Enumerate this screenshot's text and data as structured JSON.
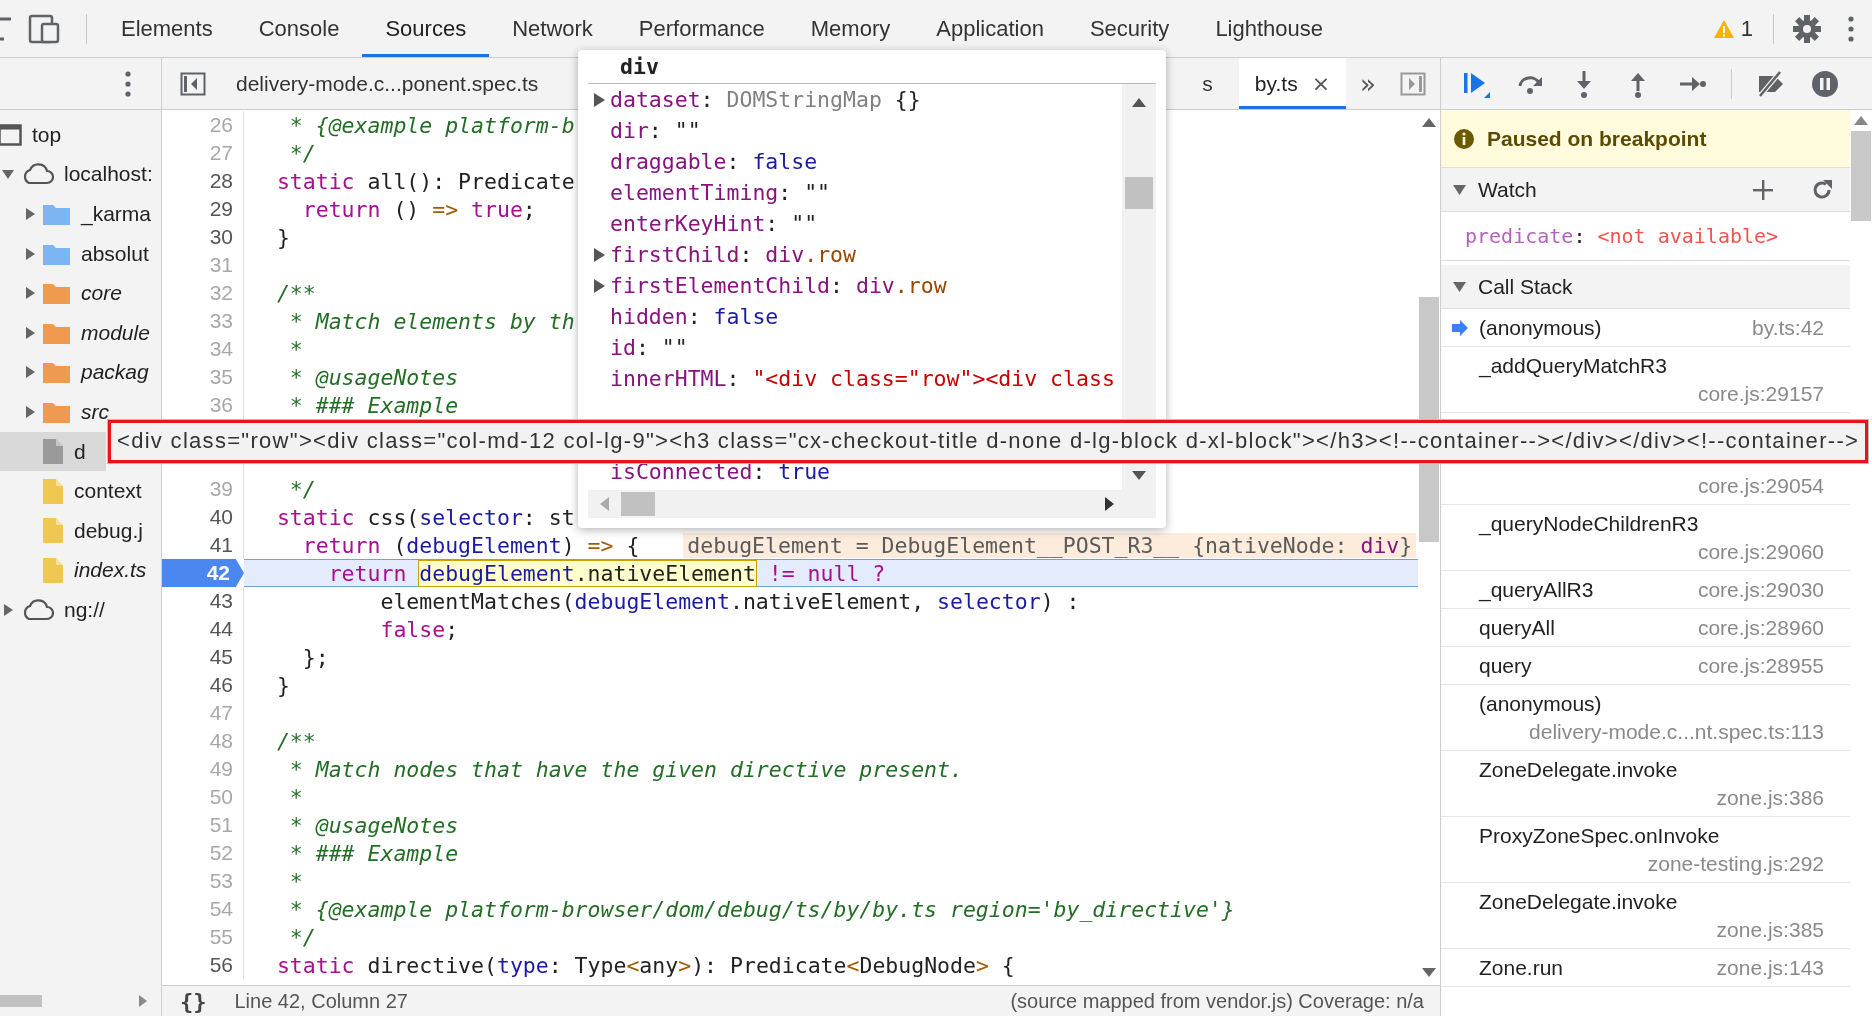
{
  "toolbar": {
    "tabs": [
      {
        "label": "Elements",
        "selected": false
      },
      {
        "label": "Console",
        "selected": false
      },
      {
        "label": "Sources",
        "selected": true
      },
      {
        "label": "Network",
        "selected": false
      },
      {
        "label": "Performance",
        "selected": false
      },
      {
        "label": "Memory",
        "selected": false
      },
      {
        "label": "Application",
        "selected": false
      },
      {
        "label": "Security",
        "selected": false
      },
      {
        "label": "Lighthouse",
        "selected": false
      }
    ],
    "warnings": "1"
  },
  "navigator": {
    "tree": [
      {
        "label": "top",
        "kind": "frame",
        "selected": false,
        "children": [
          {
            "label": "localhost:",
            "kind": "cloud",
            "selected": false,
            "expanded": true,
            "children": [
              {
                "label": "_karma",
                "kind": "folder",
                "color": "#7db4f2",
                "selected": false,
                "expanded": false,
                "source_mapped": false
              },
              {
                "label": "absolut",
                "kind": "folder",
                "color": "#7db4f2",
                "selected": false,
                "expanded": false,
                "source_mapped": false
              },
              {
                "label": "core",
                "kind": "folder",
                "color": "#ef9a4f",
                "selected": false,
                "expanded": false,
                "source_mapped": true
              },
              {
                "label": "module",
                "kind": "folder",
                "color": "#ef9a4f",
                "selected": false,
                "expanded": false,
                "source_mapped": true
              },
              {
                "label": "packag",
                "kind": "folder",
                "color": "#ef9a4f",
                "selected": false,
                "expanded": false,
                "source_mapped": true
              },
              {
                "label": "src",
                "kind": "folder",
                "color": "#ef9a4f",
                "selected": false,
                "expanded": false,
                "source_mapped": true
              },
              {
                "label": "d",
                "kind": "file",
                "color": "#9a9a9a",
                "selected": true,
                "source_mapped": false
              },
              {
                "label": "context",
                "kind": "file",
                "color": "#f0c850",
                "selected": false,
                "source_mapped": false
              },
              {
                "label": "debug.j",
                "kind": "file",
                "color": "#f0c850",
                "selected": false,
                "source_mapped": false
              },
              {
                "label": "index.ts",
                "kind": "file",
                "color": "#f0c850",
                "selected": false,
                "source_mapped": true
              }
            ]
          },
          {
            "label": "ng://",
            "kind": "cloud",
            "selected": false,
            "expanded": false
          }
        ]
      }
    ]
  },
  "editor": {
    "tabs": [
      {
        "label": "delivery-mode.c...ponent.spec.ts",
        "selected": false
      },
      {
        "label": "s",
        "selected": false
      },
      {
        "label": "by.ts",
        "selected": true,
        "close": "×"
      }
    ],
    "overflow": "»",
    "lines": [
      {
        "kind": "code",
        "number": "26",
        "breakable": false,
        "current": false,
        "breakpoint": false,
        "tokens": [
          {
            "kind": "comment",
            "text": "   * {@example platform-b"
          }
        ]
      },
      {
        "kind": "code",
        "number": "27",
        "breakable": false,
        "current": false,
        "breakpoint": false,
        "tokens": [
          {
            "kind": "comment",
            "text": "   */"
          }
        ]
      },
      {
        "kind": "code",
        "number": "28",
        "breakable": true,
        "current": false,
        "breakpoint": false,
        "tokens": [
          {
            "kind": "keyword",
            "text": "  static"
          },
          {
            "kind": "plain",
            "text": " all(): Predicate"
          }
        ]
      },
      {
        "kind": "code",
        "number": "29",
        "breakable": true,
        "current": false,
        "breakpoint": false,
        "tokens": [
          {
            "kind": "keyword",
            "text": "    return"
          },
          {
            "kind": "plain",
            "text": " () "
          },
          {
            "kind": "operator",
            "text": "=>"
          },
          {
            "kind": "keyword",
            "text": " true"
          },
          {
            "kind": "plain",
            "text": ";"
          }
        ]
      },
      {
        "kind": "code",
        "number": "30",
        "breakable": true,
        "current": false,
        "breakpoint": false,
        "tokens": [
          {
            "kind": "plain",
            "text": "  }"
          }
        ]
      },
      {
        "kind": "code",
        "number": "31",
        "breakable": false,
        "current": false,
        "breakpoint": false
      },
      {
        "kind": "code",
        "number": "32",
        "breakable": false,
        "current": false,
        "breakpoint": false,
        "tokens": [
          {
            "kind": "comment",
            "text": "  /**"
          }
        ]
      },
      {
        "kind": "code",
        "number": "33",
        "breakable": false,
        "current": false,
        "breakpoint": false,
        "tokens": [
          {
            "kind": "comment",
            "text": "   * Match elements by th"
          }
        ]
      },
      {
        "kind": "code",
        "number": "34",
        "breakable": false,
        "current": false,
        "breakpoint": false,
        "tokens": [
          {
            "kind": "comment",
            "text": "   *"
          }
        ]
      },
      {
        "kind": "code",
        "number": "35",
        "breakable": false,
        "current": false,
        "breakpoint": false,
        "tokens": [
          {
            "kind": "comment",
            "text": "   * @usageNotes"
          }
        ]
      },
      {
        "kind": "code",
        "number": "36",
        "breakable": false,
        "current": false,
        "breakpoint": false,
        "tokens": [
          {
            "kind": "comment",
            "text": "   * ### Example"
          }
        ]
      },
      {
        "kind": "covered"
      },
      {
        "kind": "covered"
      },
      {
        "kind": "code",
        "number": "39",
        "breakable": false,
        "current": false,
        "breakpoint": false,
        "tokens": [
          {
            "kind": "comment",
            "text": "   */"
          }
        ]
      },
      {
        "kind": "code",
        "number": "40",
        "breakable": true,
        "current": false,
        "breakpoint": false,
        "tokens": [
          {
            "kind": "keyword",
            "text": "  static"
          },
          {
            "kind": "plain",
            "text": " css("
          },
          {
            "kind": "variable",
            "text": "selector"
          },
          {
            "kind": "plain",
            "text": ": st"
          }
        ]
      },
      {
        "kind": "code",
        "number": "41",
        "breakable": true,
        "current": false,
        "breakpoint": false,
        "tokens": [
          {
            "kind": "keyword",
            "text": "    return"
          },
          {
            "kind": "plain",
            "text": " ("
          },
          {
            "kind": "variable",
            "text": "debugElement"
          },
          {
            "kind": "plain",
            "text": ") "
          },
          {
            "kind": "operator",
            "text": "=>"
          },
          {
            "kind": "plain",
            "text": " {"
          }
        ],
        "inline_value": [
          {
            "kind": "plain",
            "text": "debugElement = DebugElement__POST_R3__ {nativeNode: "
          },
          {
            "kind": "tag",
            "text": "div"
          },
          {
            "kind": "plain",
            "text": "}"
          }
        ]
      },
      {
        "kind": "code",
        "number": "42",
        "breakable": true,
        "current": true,
        "breakpoint": true,
        "tokens": [
          {
            "kind": "keyword",
            "text": "      return "
          },
          {
            "kind": "evaluated",
            "parts": [
              {
                "kind": "variable",
                "text": "debugElement"
              },
              {
                "kind": "plain",
                "text": ".nativeElement"
              }
            ]
          },
          {
            "kind": "keyword",
            "text": " != null ?"
          }
        ]
      },
      {
        "kind": "code",
        "number": "43",
        "breakable": true,
        "current": false,
        "breakpoint": false,
        "tokens": [
          {
            "kind": "plain",
            "text": "          elementMatches("
          },
          {
            "kind": "variable",
            "text": "debugElement"
          },
          {
            "kind": "plain",
            "text": ".nativeElement, "
          },
          {
            "kind": "variable",
            "text": "selector"
          },
          {
            "kind": "plain",
            "text": ") :"
          }
        ]
      },
      {
        "kind": "code",
        "number": "44",
        "breakable": true,
        "current": false,
        "breakpoint": false,
        "tokens": [
          {
            "kind": "keyword",
            "text": "          false"
          },
          {
            "kind": "plain",
            "text": ";"
          }
        ]
      },
      {
        "kind": "code",
        "number": "45",
        "breakable": true,
        "current": false,
        "breakpoint": false,
        "tokens": [
          {
            "kind": "plain",
            "text": "    };"
          }
        ]
      },
      {
        "kind": "code",
        "number": "46",
        "breakable": true,
        "current": false,
        "breakpoint": false,
        "tokens": [
          {
            "kind": "plain",
            "text": "  }"
          }
        ]
      },
      {
        "kind": "code",
        "number": "47",
        "breakable": false,
        "current": false,
        "breakpoint": false
      },
      {
        "kind": "code",
        "number": "48",
        "breakable": false,
        "current": false,
        "breakpoint": false,
        "tokens": [
          {
            "kind": "comment",
            "text": "  /**"
          }
        ]
      },
      {
        "kind": "code",
        "number": "49",
        "breakable": false,
        "current": false,
        "breakpoint": false,
        "tokens": [
          {
            "kind": "comment",
            "text": "   * Match nodes that have the given directive present."
          }
        ]
      },
      {
        "kind": "code",
        "number": "50",
        "breakable": false,
        "current": false,
        "breakpoint": false,
        "tokens": [
          {
            "kind": "comment",
            "text": "   *"
          }
        ]
      },
      {
        "kind": "code",
        "number": "51",
        "breakable": false,
        "current": false,
        "breakpoint": false,
        "tokens": [
          {
            "kind": "comment",
            "text": "   * @usageNotes"
          }
        ]
      },
      {
        "kind": "code",
        "number": "52",
        "breakable": false,
        "current": false,
        "breakpoint": false,
        "tokens": [
          {
            "kind": "comment",
            "text": "   * ### Example"
          }
        ]
      },
      {
        "kind": "code",
        "number": "53",
        "breakable": false,
        "current": false,
        "breakpoint": false,
        "tokens": [
          {
            "kind": "comment",
            "text": "   *"
          }
        ]
      },
      {
        "kind": "code",
        "number": "54",
        "breakable": false,
        "current": false,
        "breakpoint": false,
        "tokens": [
          {
            "kind": "comment",
            "text": "   * {@example platform-browser/dom/debug/ts/by/by.ts region='by_directive'}"
          }
        ]
      },
      {
        "kind": "code",
        "number": "55",
        "breakable": false,
        "current": false,
        "breakpoint": false,
        "tokens": [
          {
            "kind": "comment",
            "text": "   */"
          }
        ]
      },
      {
        "kind": "code",
        "number": "56",
        "breakable": true,
        "current": false,
        "breakpoint": false,
        "tokens": [
          {
            "kind": "keyword",
            "text": "  static"
          },
          {
            "kind": "plain",
            "text": " directive("
          },
          {
            "kind": "variable",
            "text": "type"
          },
          {
            "kind": "plain",
            "text": ": Type"
          },
          {
            "kind": "operator",
            "text": "<"
          },
          {
            "kind": "plain",
            "text": "any"
          },
          {
            "kind": "operator",
            "text": ">"
          },
          {
            "kind": "plain",
            "text": "): Predicate"
          },
          {
            "kind": "operator",
            "text": "<"
          },
          {
            "kind": "plain",
            "text": "DebugNode"
          },
          {
            "kind": "operator",
            "text": ">"
          },
          {
            "kind": "plain",
            "text": " {"
          }
        ]
      }
    ],
    "status": {
      "format": "{}",
      "position": "Line 42, Column 27",
      "source": "(source mapped from vendor.js) Coverage: n/a"
    }
  },
  "popup": {
    "title": "div",
    "properties": [
      {
        "kind": "property",
        "expandable": true,
        "tokens": [
          {
            "kind": "key",
            "text": "dataset"
          },
          {
            "kind": "plain",
            "text": ": "
          },
          {
            "kind": "type",
            "text": "DOMStringMap"
          },
          {
            "kind": "plain",
            "text": " {}"
          }
        ]
      },
      {
        "kind": "property",
        "expandable": false,
        "tokens": [
          {
            "kind": "key",
            "text": "dir"
          },
          {
            "kind": "plain",
            "text": ": \"\""
          }
        ]
      },
      {
        "kind": "property",
        "expandable": false,
        "tokens": [
          {
            "kind": "key",
            "text": "draggable"
          },
          {
            "kind": "plain",
            "text": ": "
          },
          {
            "kind": "boolean",
            "text": "false"
          }
        ]
      },
      {
        "kind": "property",
        "expandable": false,
        "tokens": [
          {
            "kind": "key",
            "text": "elementTiming"
          },
          {
            "kind": "plain",
            "text": ": \"\""
          }
        ]
      },
      {
        "kind": "property",
        "expandable": false,
        "tokens": [
          {
            "kind": "key",
            "text": "enterKeyHint"
          },
          {
            "kind": "plain",
            "text": ": \"\""
          }
        ]
      },
      {
        "kind": "property",
        "expandable": true,
        "tokens": [
          {
            "kind": "key",
            "text": "firstChild"
          },
          {
            "kind": "plain",
            "text": ": "
          },
          {
            "kind": "tag",
            "text": "div"
          },
          {
            "kind": "class",
            "text": ".row"
          }
        ]
      },
      {
        "kind": "property",
        "expandable": true,
        "tokens": [
          {
            "kind": "key",
            "text": "firstElementChild"
          },
          {
            "kind": "plain",
            "text": ": "
          },
          {
            "kind": "tag",
            "text": "div"
          },
          {
            "kind": "class",
            "text": ".row"
          }
        ]
      },
      {
        "kind": "property",
        "expandable": false,
        "tokens": [
          {
            "kind": "key",
            "text": "hidden"
          },
          {
            "kind": "plain",
            "text": ": "
          },
          {
            "kind": "boolean",
            "text": "false"
          }
        ]
      },
      {
        "kind": "property",
        "expandable": false,
        "tokens": [
          {
            "kind": "key",
            "text": "id"
          },
          {
            "kind": "plain",
            "text": ": \"\""
          }
        ]
      },
      {
        "kind": "property",
        "expandable": false,
        "tokens": [
          {
            "kind": "key",
            "text": "innerHTML"
          },
          {
            "kind": "plain",
            "text": ": "
          },
          {
            "kind": "string",
            "text": "\"<div class=\"row\"><div class"
          }
        ]
      },
      {
        "kind": "covered"
      },
      {
        "kind": "covered"
      },
      {
        "kind": "property",
        "expandable": false,
        "tokens": [
          {
            "kind": "key",
            "text": "isConnected"
          },
          {
            "kind": "plain",
            "text": ": "
          },
          {
            "kind": "boolean",
            "text": "true"
          }
        ]
      }
    ]
  },
  "tooltip": {
    "text": "<div class=\"row\"><div class=\"col-md-12 col-lg-9\"><h3 class=\"cx-checkout-title d-none d-lg-block d-xl-block\"></h3><!--container--></div></div><!--container-->"
  },
  "debugger": {
    "status": "Paused on breakpoint",
    "watch": {
      "title": "Watch",
      "expanded": true,
      "expressions": [
        {
          "tokens": [
            {
              "kind": "name",
              "text": "predicate"
            },
            {
              "kind": "plain",
              "text": ": "
            },
            {
              "kind": "error",
              "text": "<not available>"
            }
          ]
        }
      ]
    },
    "call_stack": {
      "title": "Call Stack",
      "expanded": true,
      "frames": [
        {
          "name": "(anonymous)",
          "location": "by.ts:42",
          "current": true
        },
        {
          "name": "_addQueryMatchR3",
          "location": "core.js:29157",
          "current": false
        },
        {
          "location": "core.js:29054",
          "current": false
        },
        {
          "name": "_queryNodeChildrenR3",
          "location": "core.js:29060",
          "current": false
        },
        {
          "name": "_queryAllR3",
          "location": "core.js:29030",
          "current": false
        },
        {
          "name": "queryAll",
          "location": "core.js:28960",
          "current": false
        },
        {
          "name": "query",
          "location": "core.js:28955",
          "current": false
        },
        {
          "name": "(anonymous)",
          "location": "delivery-mode.c...nt.spec.ts:113",
          "current": false
        },
        {
          "name": "ZoneDelegate.invoke",
          "location": "zone.js:386",
          "current": false
        },
        {
          "name": "ProxyZoneSpec.onInvoke",
          "location": "zone-testing.js:292",
          "current": false
        },
        {
          "name": "ZoneDelegate.invoke",
          "location": "zone.js:385",
          "current": false
        },
        {
          "name": "Zone.run",
          "location": "zone.js:143",
          "current": false
        }
      ]
    }
  }
}
